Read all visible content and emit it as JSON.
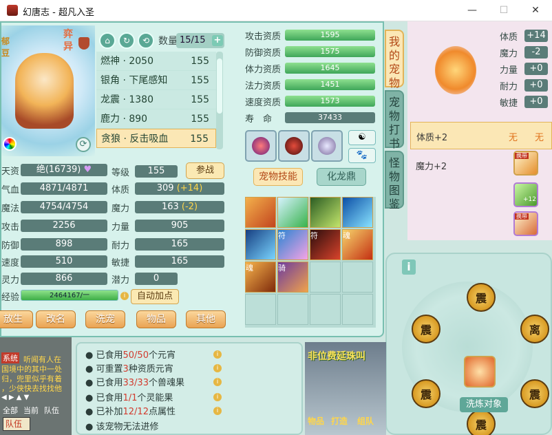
{
  "window": {
    "title": "幻唐志 - 超凡入圣",
    "minimize": "—",
    "maximize": "☐",
    "close": "✕"
  },
  "pet": {
    "name_badge": "弈异",
    "portrait_tag": "郁豆",
    "quantity_label": "数量",
    "quantity_value": "15/15",
    "list": [
      {
        "name": "燃神 · 2050",
        "level": "155"
      },
      {
        "name": "银角 · 下尾感知",
        "level": "155"
      },
      {
        "name": "龙震 · 1380",
        "level": "155"
      },
      {
        "name": "鹿力 · 890",
        "level": "155"
      },
      {
        "name": "贪狼 · 反击吸血",
        "level": "155"
      }
    ],
    "stats_left": [
      {
        "label": "天资",
        "value": "绝(16739)"
      },
      {
        "label": "气血",
        "value": "4871/4871"
      },
      {
        "label": "魔法",
        "value": "4754/4754"
      },
      {
        "label": "攻击",
        "value": "2256"
      },
      {
        "label": "防御",
        "value": "898"
      },
      {
        "label": "速度",
        "value": "510"
      },
      {
        "label": "灵力",
        "value": "866"
      }
    ],
    "stats_mid": [
      {
        "label": "等级",
        "value": "155",
        "bonus": ""
      },
      {
        "label": "体质",
        "value": "309",
        "bonus": "(+14)"
      },
      {
        "label": "魔力",
        "value": "163",
        "bonus": "(-2)"
      },
      {
        "label": "力量",
        "value": "905",
        "bonus": ""
      },
      {
        "label": "耐力",
        "value": "165",
        "bonus": ""
      },
      {
        "label": "敏捷",
        "value": "165",
        "bonus": ""
      },
      {
        "label": "潜力",
        "value": "0",
        "bonus": ""
      }
    ],
    "battle_button": "参战",
    "exp_label": "经验",
    "exp_text": "2464167/一",
    "exp_fraction": 1.0,
    "auto_points": "自动加点",
    "bottom_buttons": [
      "放生",
      "改名",
      "洗宠",
      "物品",
      "其他"
    ],
    "aptitudes": [
      {
        "label": "攻击资质",
        "value": "1595"
      },
      {
        "label": "防御资质",
        "value": "1575"
      },
      {
        "label": "体力资质",
        "value": "1645"
      },
      {
        "label": "法力资质",
        "value": "1451"
      },
      {
        "label": "速度资质",
        "value": "1573"
      },
      {
        "label": "寿　命",
        "value": "37433"
      }
    ],
    "tab_skills": "宠物技能",
    "tab_dragon": "化龙鼎",
    "skill_labels": [
      "",
      "",
      "",
      "",
      "",
      "符",
      "符",
      "魂",
      "魂",
      "骑",
      "",
      "",
      "",
      "",
      "",
      ""
    ]
  },
  "side_tabs": [
    "我的宠物",
    "宠物打书",
    "怪物图鉴"
  ],
  "right_panel": {
    "stats": [
      {
        "label": "体质",
        "value": "+14"
      },
      {
        "label": "魔力",
        "value": "-2"
      },
      {
        "label": "力量",
        "value": "+0"
      },
      {
        "label": "耐力",
        "value": "+0"
      },
      {
        "label": "敏捷",
        "value": "+0"
      }
    ],
    "rows": [
      {
        "text": "体质+2",
        "col1": "无",
        "col2": "无"
      },
      {
        "text": "魔力+2",
        "col1": "",
        "col2": ""
      }
    ],
    "item_badges": [
      "携带",
      "+12",
      "携带"
    ]
  },
  "wheel": {
    "runes": [
      "震",
      "震",
      "离",
      "震",
      "震",
      "震"
    ],
    "wash_target": "洗炼对象",
    "info_icon": "i"
  },
  "chat": {
    "system_tag": "系统",
    "lines": [
      "听闻有人在",
      "国境中的其中一处",
      "归，兜里似乎有着",
      "，少侠快去找找他"
    ],
    "filters": [
      "全部",
      "当前",
      "队伍"
    ],
    "team_label": "队伍"
  },
  "info": {
    "lines": [
      {
        "pre": "已食用",
        "num": "50/50",
        "post": "个元宵"
      },
      {
        "pre": "可重置",
        "num": "3",
        "post": "种资质元宵"
      },
      {
        "pre": "已食用",
        "num": "33/33",
        "post": "个兽魂果"
      },
      {
        "pre": "已食用",
        "num": "1/1",
        "post": "个灵能果"
      },
      {
        "pre": "已补加",
        "num": "12/12",
        "post": "点属性"
      },
      {
        "pre": "该宠物无法进修",
        "num": "",
        "post": ""
      }
    ]
  },
  "scene": {
    "banner": "非位费延珠叫",
    "tiles": [
      "物品",
      "打造",
      "组队"
    ]
  }
}
